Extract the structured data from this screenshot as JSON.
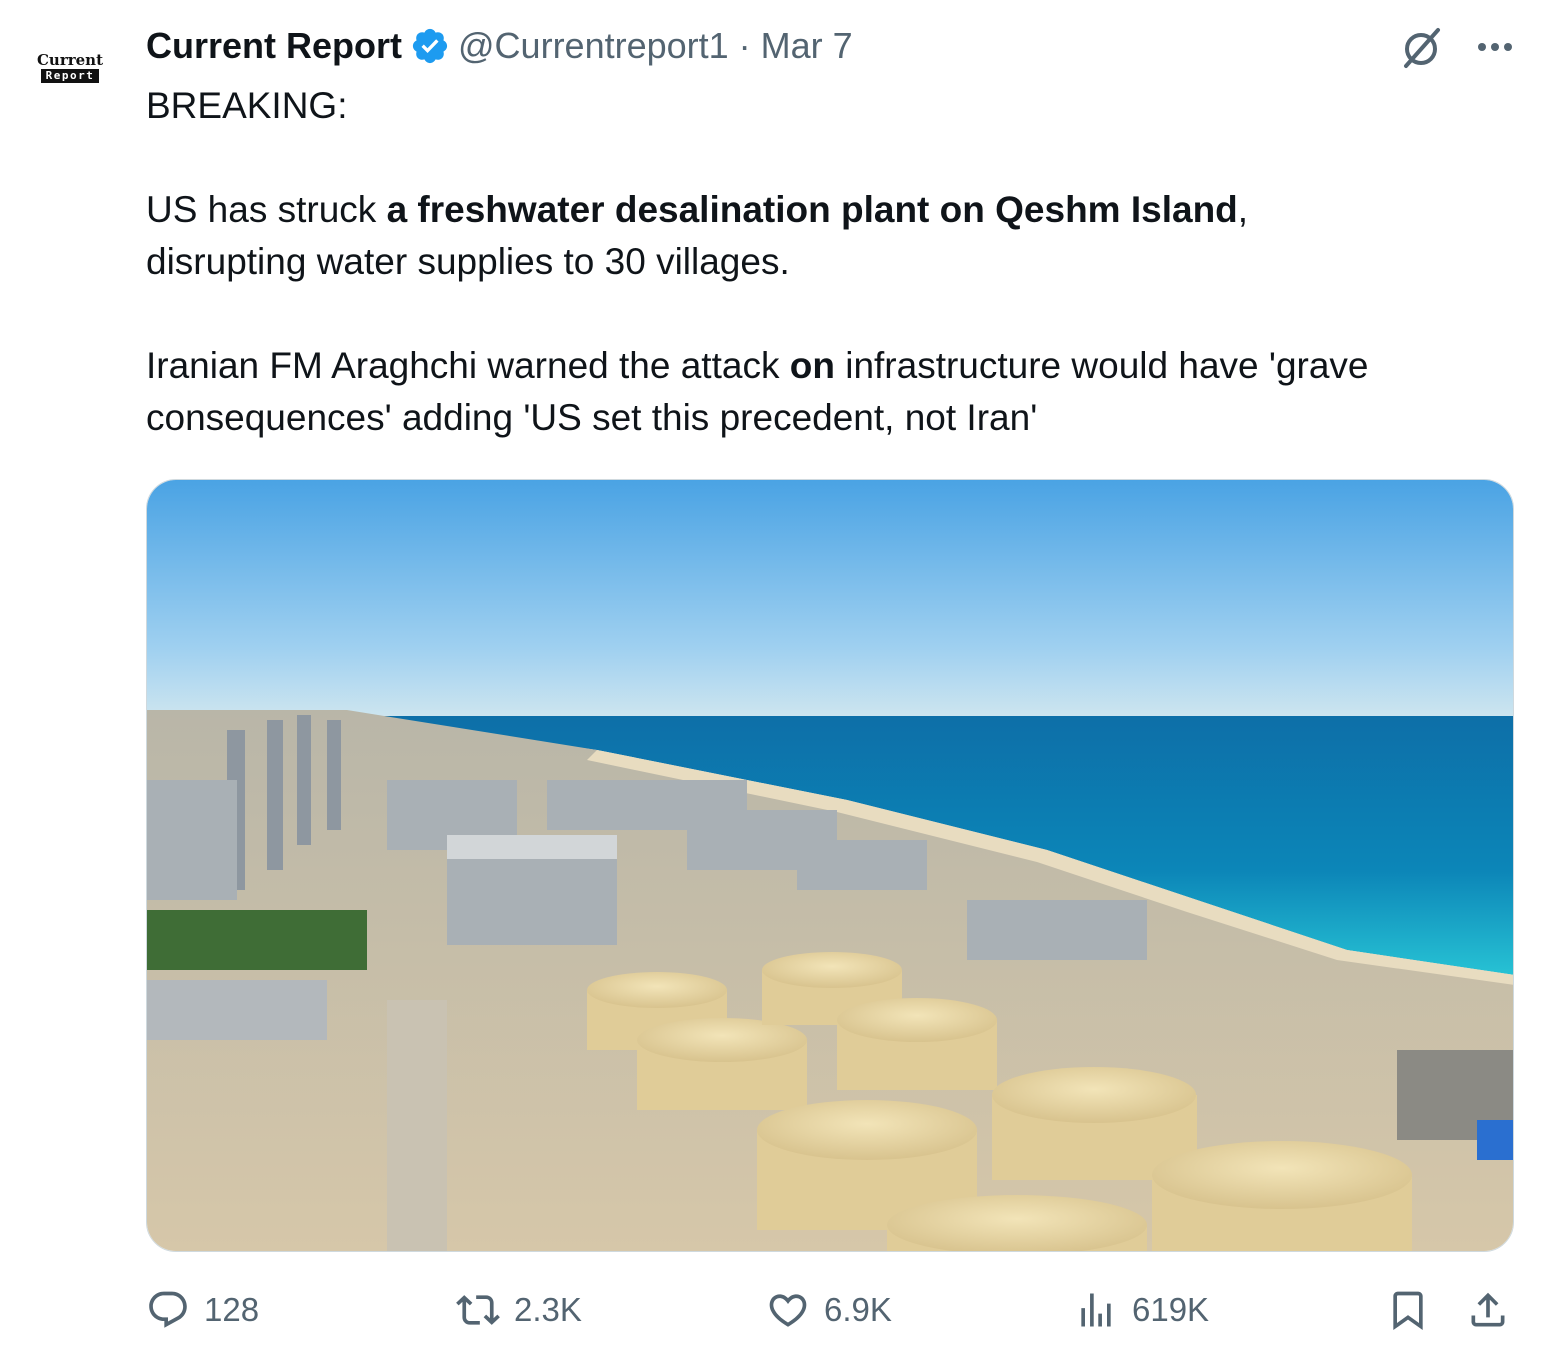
{
  "author": {
    "display_name": "Current Report",
    "handle": "@Currentreport1",
    "separator": "·",
    "date": "Mar 7",
    "avatar_line1": "Current",
    "avatar_line2": "Report",
    "verified_color": "#1d9bf0"
  },
  "tweet": {
    "line_breaking": "BREAKING:",
    "p1_a": "US has struck ",
    "p1_bold": "a freshwater desalination plant on Qeshm Island",
    "p1_b": ",",
    "p1_c": "disrupting water supplies to 30 villages.",
    "p2_a": "Iranian FM Araghchi warned the attack ",
    "p2_bold": "on",
    "p2_b": " infrastructure would have 'grave",
    "p2_c": "consequences' adding 'US set this precedent, not Iran'"
  },
  "media": {
    "icon": "desalination-plant-photo"
  },
  "actions": {
    "replies": "128",
    "reposts": "2.3K",
    "likes": "6.9K",
    "views": "619K"
  },
  "colors": {
    "text": "#0f1419",
    "secondary": "#536471",
    "border": "#cfd9de"
  }
}
